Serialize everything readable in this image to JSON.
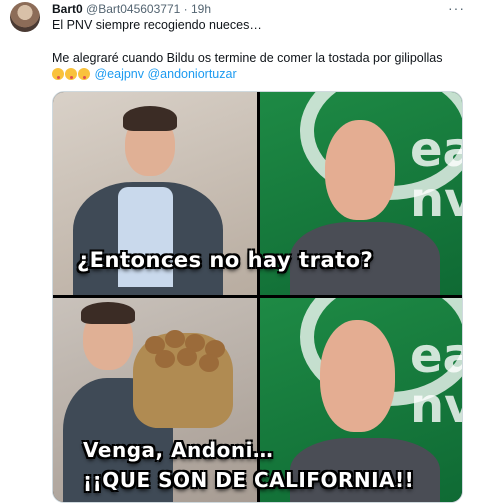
{
  "tweet": {
    "display_name": "Bart0",
    "handle": "@Bart045603771",
    "separator": "·",
    "time": "19h",
    "more_icon": "more-icon",
    "line1": "El PNV siempre recogiendo nueces…",
    "line2": "Me alegraré cuando Bildu os termine de comer la tostada por gilipollas",
    "line3_mentions": "@eajpnv @andoniortuzar"
  },
  "media": {
    "caption_top": "¿Entonces no hay trato?",
    "caption_bottom_1": "Venga, Andoni…",
    "caption_bottom_2": "¡¡QUE SON DE CALIFORNIA!!",
    "logo_text": "ea\nonv"
  }
}
